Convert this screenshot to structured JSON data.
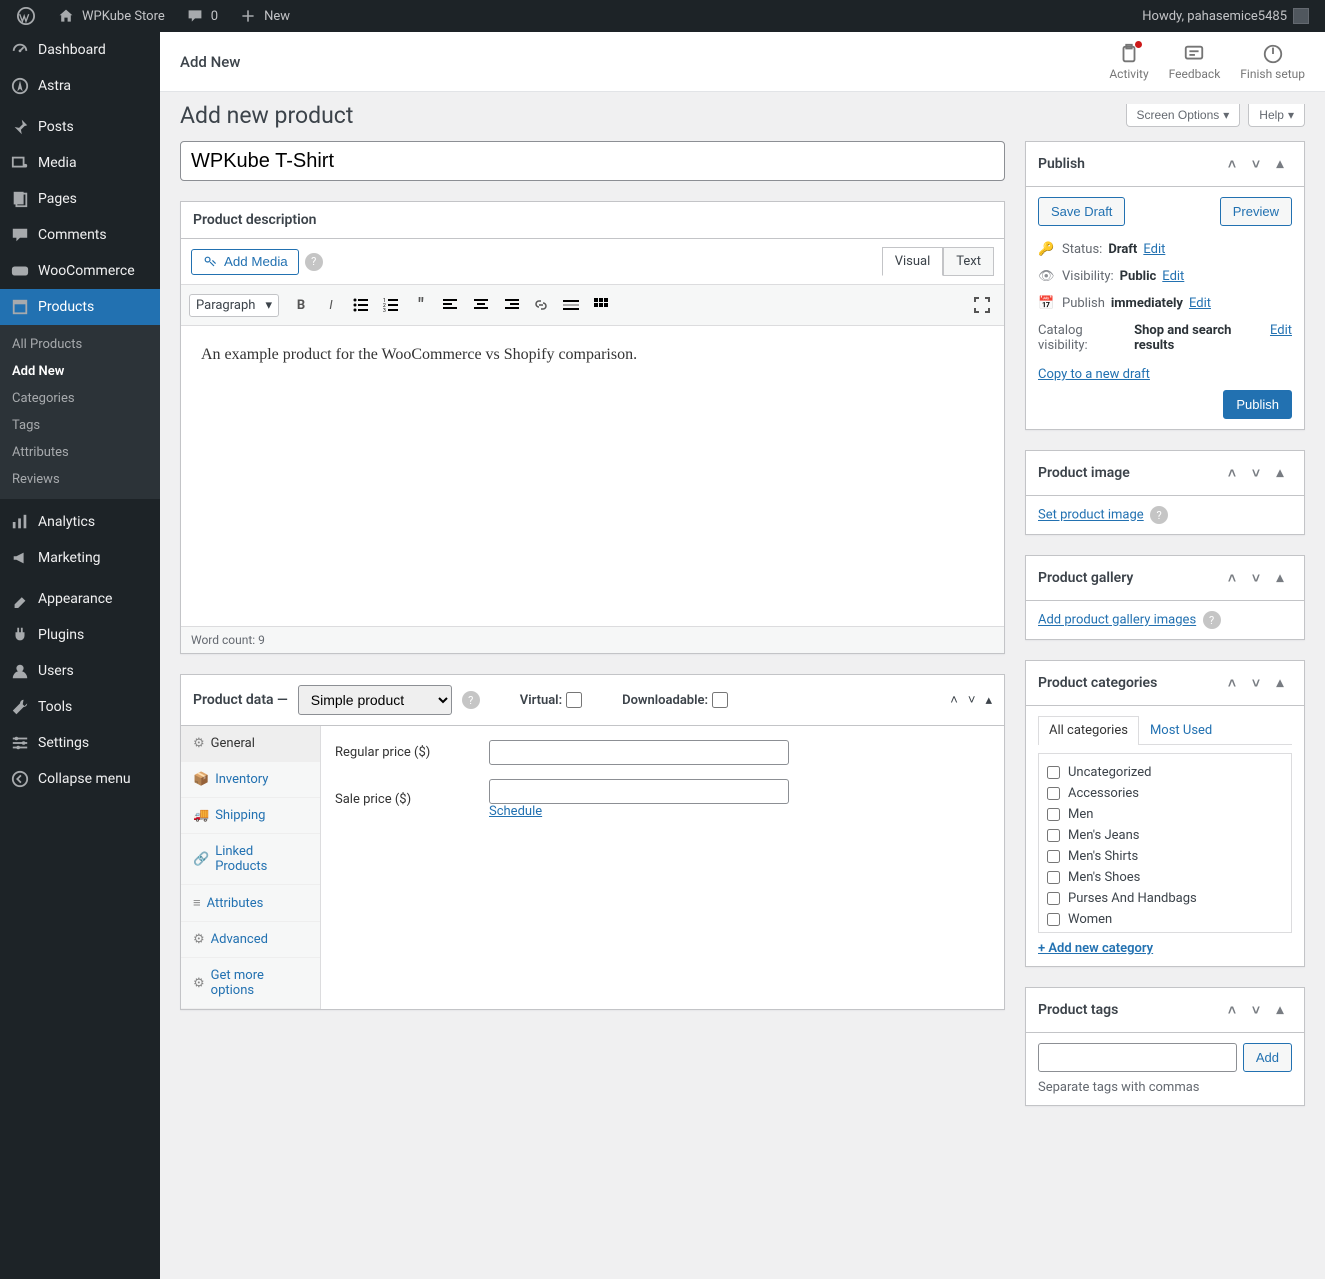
{
  "adminbar": {
    "site": "WPKube Store",
    "comments": "0",
    "new": "New",
    "howdy": "Howdy, pahasemice5485"
  },
  "sidebar": {
    "items": [
      {
        "label": "Dashboard",
        "icon": "dash"
      },
      {
        "label": "Astra",
        "icon": "astra"
      },
      {
        "label": "Posts",
        "icon": "pin"
      },
      {
        "label": "Media",
        "icon": "media"
      },
      {
        "label": "Pages",
        "icon": "page"
      },
      {
        "label": "Comments",
        "icon": "comment"
      },
      {
        "label": "WooCommerce",
        "icon": "woo"
      },
      {
        "label": "Products",
        "icon": "products",
        "current": true
      },
      {
        "label": "Analytics",
        "icon": "analytics"
      },
      {
        "label": "Marketing",
        "icon": "marketing"
      },
      {
        "label": "Appearance",
        "icon": "appearance"
      },
      {
        "label": "Plugins",
        "icon": "plugins"
      },
      {
        "label": "Users",
        "icon": "users"
      },
      {
        "label": "Tools",
        "icon": "tools"
      },
      {
        "label": "Settings",
        "icon": "settings"
      },
      {
        "label": "Collapse menu",
        "icon": "collapse"
      }
    ],
    "submenu": [
      "All Products",
      "Add New",
      "Categories",
      "Tags",
      "Attributes",
      "Reviews"
    ],
    "submenu_current": "Add New"
  },
  "topstrip": {
    "title": "Add New",
    "actions": [
      {
        "label": "Activity",
        "icon": "activity",
        "dot": true
      },
      {
        "label": "Feedback",
        "icon": "feedback"
      },
      {
        "label": "Finish setup",
        "icon": "finish"
      }
    ]
  },
  "page": {
    "heading": "Add new product",
    "screen_options": "Screen Options",
    "help": "Help",
    "product_title": "WPKube T-Shirt"
  },
  "editor": {
    "box_title": "Product description",
    "add_media": "Add Media",
    "tabs": {
      "visual": "Visual",
      "text": "Text"
    },
    "paragraph": "Paragraph",
    "content": "An example product for the WooCommerce vs Shopify comparison.",
    "wordcount": "Word count: 9"
  },
  "product_data": {
    "label": "Product data —",
    "type": "Simple product",
    "virtual": "Virtual:",
    "downloadable": "Downloadable:",
    "tabs": [
      "General",
      "Inventory",
      "Shipping",
      "Linked Products",
      "Attributes",
      "Advanced",
      "Get more options"
    ],
    "regular_price_label": "Regular price ($)",
    "sale_price_label": "Sale price ($)",
    "schedule": "Schedule"
  },
  "publish": {
    "title": "Publish",
    "save_draft": "Save Draft",
    "preview": "Preview",
    "status_label": "Status:",
    "status_value": "Draft",
    "edit": "Edit",
    "visibility_label": "Visibility:",
    "visibility_value": "Public",
    "schedule_label": "Publish",
    "schedule_value": "immediately",
    "catalog_label": "Catalog visibility:",
    "catalog_value": "Shop and search results",
    "copy": "Copy to a new draft",
    "publish_btn": "Publish"
  },
  "product_image": {
    "title": "Product image",
    "link": "Set product image"
  },
  "product_gallery": {
    "title": "Product gallery",
    "link": "Add product gallery images"
  },
  "categories": {
    "title": "Product categories",
    "tab_all": "All categories",
    "tab_most": "Most Used",
    "items": [
      "Uncategorized",
      "Accessories",
      "Men",
      "Men's Jeans",
      "Men's Shirts",
      "Men's Shoes",
      "Purses And Handbags",
      "Women"
    ],
    "add": "+ Add new category"
  },
  "tags": {
    "title": "Product tags",
    "add": "Add",
    "hint": "Separate tags with commas"
  }
}
